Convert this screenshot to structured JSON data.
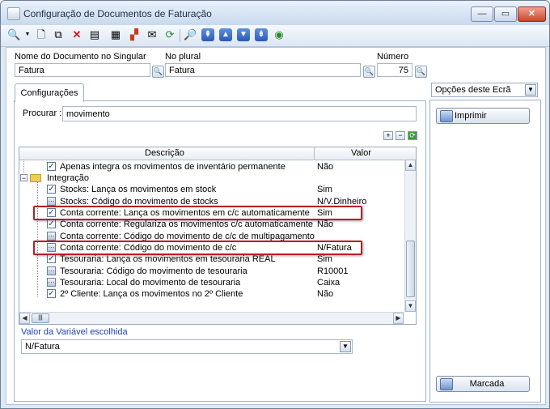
{
  "window": {
    "title": "Configuração de Documentos de Faturação"
  },
  "fields": {
    "singular_label": "Nome do Documento no Singular",
    "singular_value": "Fatura",
    "plural_label": "No plural",
    "plural_value": "Fatura",
    "number_label": "Número",
    "number_value": "75"
  },
  "tabs": {
    "configuracoes": "Configurações"
  },
  "search": {
    "label": "Procurar :",
    "value": "movimento"
  },
  "grid": {
    "col_desc": "Descrição",
    "col_val": "Valor",
    "rows": [
      {
        "desc": "Apenas integra os movimentos de inventário permanente",
        "val": "Não"
      },
      {
        "desc": "Integração",
        "val": ""
      },
      {
        "desc": "Stocks: Lança os movimentos em stock",
        "val": "Sim"
      },
      {
        "desc": "Stocks: Código do movimento de stocks",
        "val": "N/V.Dinheiro"
      },
      {
        "desc": "Conta corrente: Lança os movimentos em c/c automaticamente",
        "val": "Sim"
      },
      {
        "desc": "Conta corrente: Regulariza os movimentos c/c automaticamente",
        "val": "Não"
      },
      {
        "desc": "Conta corrente: Código do movimento de c/c de multipagamento",
        "val": ""
      },
      {
        "desc": "Conta corrente: Código do movimento de c/c",
        "val": "N/Fatura"
      },
      {
        "desc": "Tesouraria: Lança os movimentos em tesouraria REAL",
        "val": "Sim"
      },
      {
        "desc": "Tesouraria: Código do movimento de tesouraria",
        "val": "R10001"
      },
      {
        "desc": "Tesouraria: Local do movimento de tesouraria",
        "val": "Caixa"
      },
      {
        "desc": "2º Cliente: Lança os movimentos no 2º Cliente",
        "val": "Não"
      }
    ]
  },
  "variable": {
    "label": "Valor da Variável escolhida",
    "value": "N/Fatura"
  },
  "right_panel": {
    "options_label": "Opções deste Ecrã",
    "print_button": "Imprimir",
    "marked_button": "Marcada"
  },
  "colors": {
    "highlight": "#b22128",
    "accent_label": "#1d43b5"
  }
}
